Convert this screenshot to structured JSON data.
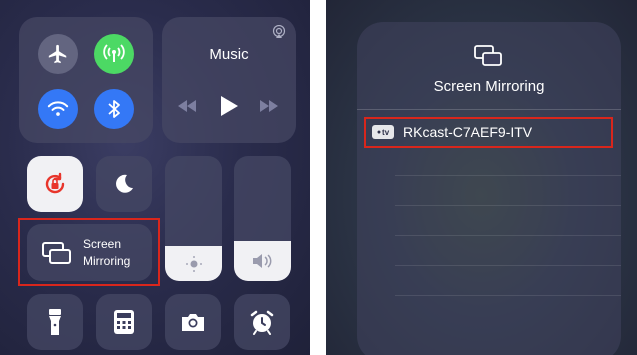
{
  "left_panel": {
    "music": {
      "title": "Music"
    },
    "screen_mirroring": {
      "line1": "Screen",
      "line2": "Mirroring"
    }
  },
  "right_panel": {
    "title": "Screen Mirroring",
    "device": {
      "badge": "tv",
      "name": "RKcast-C7AEF9-ITV"
    }
  },
  "colors": {
    "airplane_bg": "#636580",
    "cellular_bg": "#4cd964",
    "wifi_bg": "#3478f6",
    "bluetooth_bg": "#3478f6",
    "rotation_lock_icon": "#e8352b",
    "highlight_border": "#d9261c"
  },
  "levels": {
    "brightness": 0.28,
    "volume": 0.32
  }
}
